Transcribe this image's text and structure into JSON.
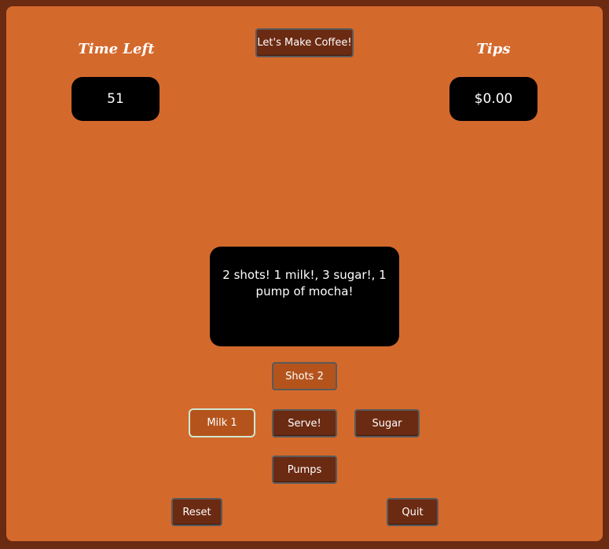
{
  "header": {
    "start_button": "Let's Make Coffee!",
    "time_label": "Time Left",
    "time_value": "51",
    "tips_label": "Tips",
    "tips_value": "$0.00"
  },
  "order": {
    "text": "2 shots! 1 milk!, 3 sugar!, 1 pump of mocha!"
  },
  "controls": {
    "shots": "Shots 2",
    "milk": "Milk 1",
    "serve": "Serve!",
    "sugar": "Sugar",
    "pumps": "Pumps",
    "reset": "Reset",
    "quit": "Quit"
  },
  "colors": {
    "outer_border": "#6b2a12",
    "background": "#d4692c",
    "button_dark": "#6b2a12",
    "button_active": "#b4541c",
    "display": "#000000"
  }
}
